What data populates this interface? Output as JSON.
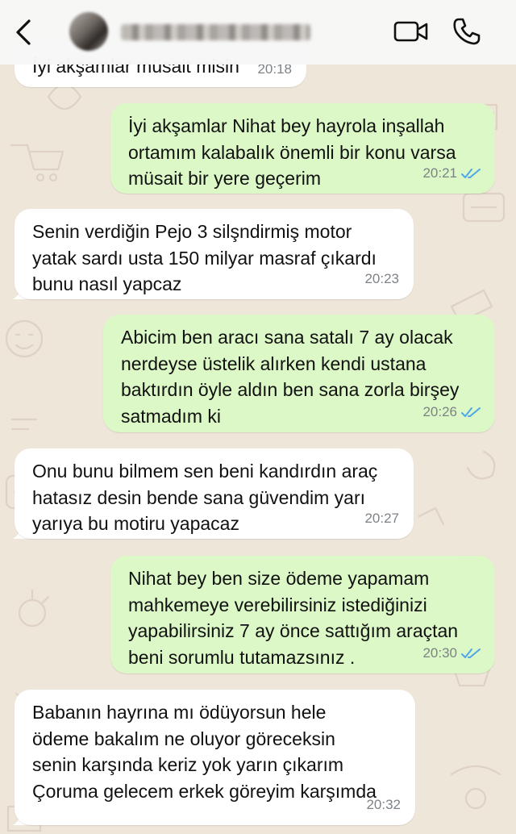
{
  "header": {
    "contact_name": "████ █████ ████"
  },
  "messages": [
    {
      "direction": "in",
      "text": "İyi akşamlar müsait misin",
      "time": "20:18"
    },
    {
      "direction": "out",
      "text": "İyi akşamlar Nihat bey hayrola inşallah\nortamım kalabalık önemli bir konu varsa\nmüsait bir yere geçerim",
      "time": "20:21",
      "status": "read"
    },
    {
      "direction": "in",
      "text": "Senin verdiğin Pejo 3 silşndirmiş motor\nyatak sardı usta 150 milyar masraf çıkardı\nbunu nasıl yapcaz",
      "time": "20:23"
    },
    {
      "direction": "out",
      "text": "Abicim ben aracı sana satalı 7 ay olacak\nnerdeyse üstelik alırken kendi ustana\nbaktırdın öyle aldın ben sana zorla birşey\nsatmadım ki",
      "time": "20:26",
      "status": "read"
    },
    {
      "direction": "in",
      "text": "Onu bunu bilmem sen beni kandırdın araç\nhatasız desin bende sana güvendim yarı\nyarıya bu motiru yapacaz",
      "time": "20:27"
    },
    {
      "direction": "out",
      "text": "Nihat bey ben size ödeme yapamam\nmahkemeye verebilirsiniz istediğinizi\nyapabilirsiniz 7 ay önce sattığım araçtan\nbeni sorumlu tutamazsınız .",
      "time": "20:30",
      "status": "read"
    },
    {
      "direction": "in",
      "text": "Babanın hayrına mı ödüyorsun hele\nödeme bakalım ne oluyor göreceksin\nsenin karşında keriz yok yarın çıkarım\nÇoruma gelecem erkek göreyim karşımda",
      "time": "20:32"
    }
  ],
  "colors": {
    "outgoing_bubble": "#dbf8c6",
    "incoming_bubble": "#ffffff",
    "read_ticks": "#4fa6e8",
    "chat_background": "#efe6da"
  },
  "icons": [
    "back-chevron-icon",
    "video-call-icon",
    "phone-icon",
    "double-check-icon"
  ]
}
